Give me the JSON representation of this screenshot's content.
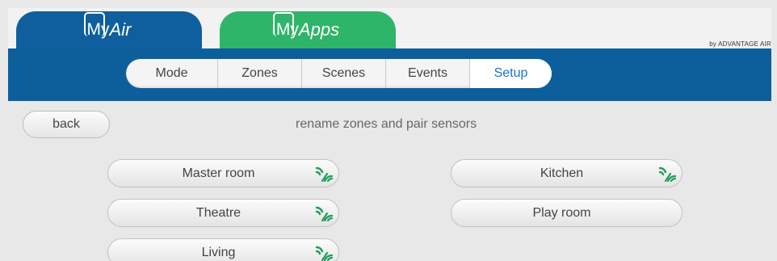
{
  "apps": {
    "myair": {
      "my": "My",
      "name": "Air"
    },
    "myapps": {
      "my": "My",
      "name": "Apps"
    }
  },
  "brand": "by ADVANTAGE AIR",
  "nav": {
    "tabs": [
      {
        "label": "Mode",
        "active": false
      },
      {
        "label": "Zones",
        "active": false
      },
      {
        "label": "Scenes",
        "active": false
      },
      {
        "label": "Events",
        "active": false
      },
      {
        "label": "Setup",
        "active": true
      }
    ]
  },
  "page": {
    "back_label": "back",
    "heading": "rename zones and pair sensors"
  },
  "zones": [
    {
      "name": "Master room",
      "sensor_paired": true
    },
    {
      "name": "Kitchen",
      "sensor_paired": true
    },
    {
      "name": "Theatre",
      "sensor_paired": true
    },
    {
      "name": "Play room",
      "sensor_paired": false
    },
    {
      "name": "Living",
      "sensor_paired": true
    }
  ],
  "colors": {
    "nav_blue": "#0d5f9c",
    "myapps_green": "#2fb56a",
    "active_tab_text": "#1a73c9",
    "sensor_green": "#1f9e5a"
  }
}
